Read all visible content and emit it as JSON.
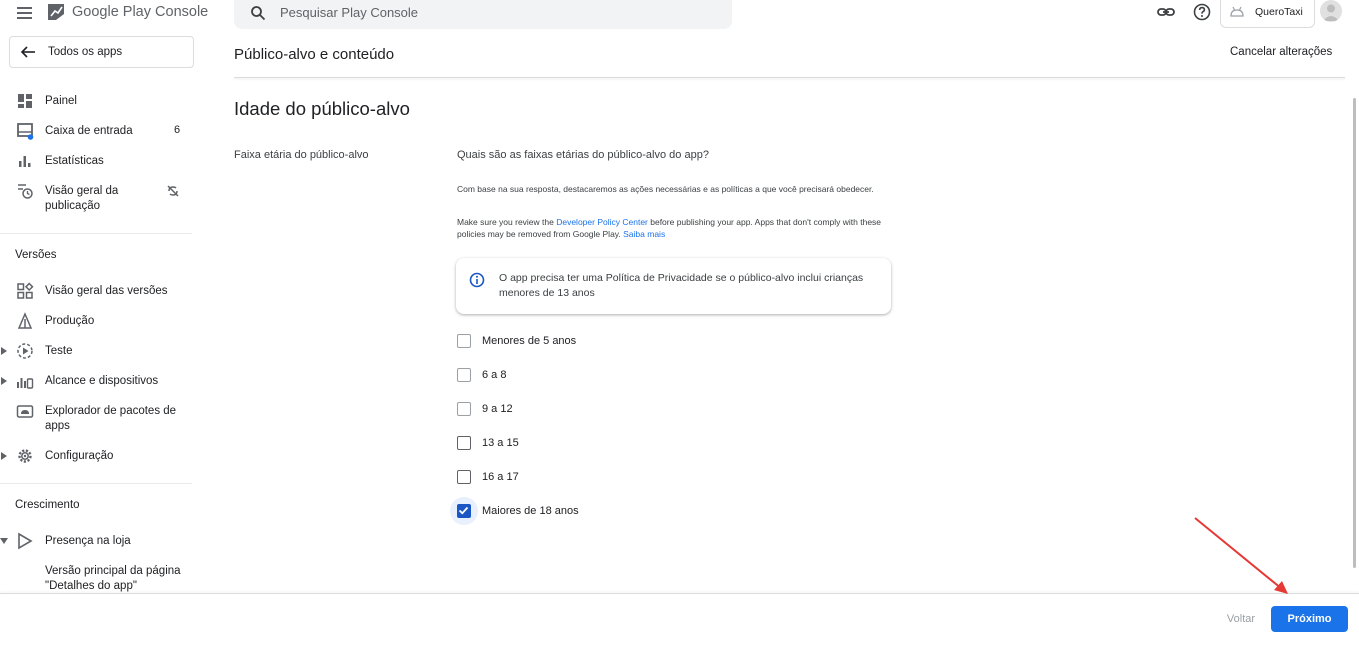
{
  "header": {
    "logo_google_play": "Google Play",
    "logo_console": "Console",
    "search_placeholder": "Pesquisar Play Console",
    "app_name": "QueroTaxi"
  },
  "sidebar": {
    "all_apps": "Todos os apps",
    "items": [
      {
        "label": "Painel",
        "icon": "dashboard-icon"
      },
      {
        "label": "Caixa de entrada",
        "icon": "inbox-icon",
        "count": "6"
      },
      {
        "label": "Estatísticas",
        "icon": "bar-chart-icon"
      },
      {
        "label": "Visão geral da publicação",
        "icon": "publishing-overview-icon",
        "badge_icon": "sync-disabled-icon"
      }
    ],
    "section_versions": "Versões",
    "version_items": [
      {
        "label": "Visão geral das versões",
        "icon": "releases-overview-icon"
      },
      {
        "label": "Produção",
        "icon": "production-icon"
      },
      {
        "label": "Teste",
        "icon": "test-icon",
        "expandable": true
      },
      {
        "label": "Alcance e dispositivos",
        "icon": "reach-devices-icon",
        "expandable": true
      },
      {
        "label": "Explorador de pacotes de apps",
        "icon": "bundle-explorer-icon"
      },
      {
        "label": "Configuração",
        "icon": "settings-gear-icon",
        "expandable": true
      }
    ],
    "section_growth": "Crescimento",
    "growth_items": [
      {
        "label": "Presença na loja",
        "icon": "play-store-icon",
        "expanded": true
      },
      {
        "label": "Versão principal da página \"Detalhes do app\""
      }
    ]
  },
  "main": {
    "page_title": "Público-alvo e conteúdo",
    "cancel_changes": "Cancelar alterações",
    "section_title": "Idade do público-alvo",
    "field_label": "Faixa etária do público-alvo",
    "question": "Quais são as faixas etárias do público-alvo do app?",
    "help_text_1": "Com base na sua resposta, destacaremos as ações necessárias e as políticas a que você precisará obedecer.",
    "help_text_2_pre": "Make sure you review the ",
    "help_text_2_link": "Developer Policy Center",
    "help_text_2_mid": " before publishing your app. Apps that don't comply with these policies may be removed from Google Play. ",
    "help_text_2_link2": "Saiba mais",
    "notice": "O app precisa ter uma Política de Privacidade se o público-alvo inclui crianças menores de 13 anos",
    "age_options": [
      {
        "label": "Menores de 5 anos",
        "checked": false
      },
      {
        "label": "6 a 8",
        "checked": false
      },
      {
        "label": "9 a 12",
        "checked": false
      },
      {
        "label": "13 a 15",
        "checked": false
      },
      {
        "label": "16 a 17",
        "checked": false
      },
      {
        "label": "Maiores de 18 anos",
        "checked": true
      }
    ]
  },
  "footer": {
    "back": "Voltar",
    "next": "Próximo"
  },
  "colors": {
    "primary": "#1a73e8",
    "checkbox_checked": "#1a56c4",
    "annotation_arrow": "#e53935"
  }
}
